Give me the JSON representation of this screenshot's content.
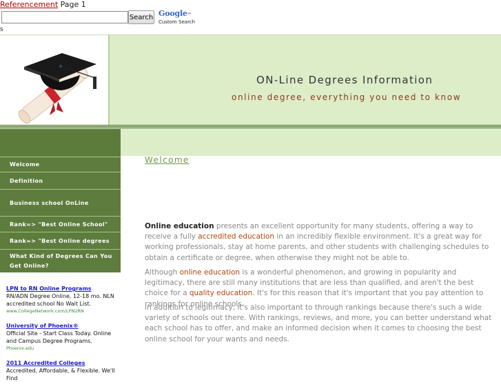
{
  "topbar": {
    "link": "Referencement",
    "page": "Page 1"
  },
  "search": {
    "button_label": "Search",
    "placeholder": ""
  },
  "google": {
    "logo": "Google",
    "tm": "™",
    "custom": "Custom Search"
  },
  "stray_char": "s",
  "header": {
    "title": "ON-Line Degrees Information",
    "subtitle": "online degree, everything you need to know"
  },
  "nav": [
    "Welcome",
    "Definition",
    "Business school OnLine",
    "Rank=> \"Best Online School\"",
    "Rank=> \"Best Online degrees",
    "What Kind of Degrees Can You Get Online?"
  ],
  "ads": [
    {
      "title": "LPN to RN Online Programs",
      "text": "RN/ADN Degree Online, 12-18 mo. NLN accredited school No Wait List.",
      "url": "www.CollegeNetwork.com/LPN2RN"
    },
    {
      "title": "University of Phoenix®",
      "text": "Official Site - Start Class Today. Online and Campus Degree Programs.",
      "url": "Phoenix.edu"
    },
    {
      "title": "2011 Accredited Colleges",
      "text": "Accredited, Affordable, & Flexible. We'll Find",
      "url": ""
    }
  ],
  "content": {
    "heading": "Welcome",
    "p1": {
      "a": "Online education",
      "b": " presents an excellent opportunity for many students, offering a way to receive a fully ",
      "c": "accredited education",
      "d": " in an incredibly flexible environment. It's a great way for working professionals, stay at home parents, and other students with challenging schedules to obtain a certificate or degree, when otherwise they might not be able to."
    },
    "p2": {
      "a": "Although ",
      "b": "online education",
      "c": " is a wonderful phenomenon, and growing in popularity and legitimacy, there are still many institutions that are less than qualified, and aren't the best choice for a ",
      "d": "quality education",
      "e": ". It's for this reason that it's important that you pay attention to rankings for online schools."
    },
    "p3": "In addition to legitimacy, it's also important to through rankings because there's such a wide variety of schools out there. With rankings, reviews, and more, you can better understand what each school has to offer, and make an informed decision when it comes to choosing the best online school for your wants and needs."
  },
  "colors": {
    "green_dark": "#5d7c3d",
    "green_light": "#dcedc8",
    "accent": "#b0470e"
  }
}
